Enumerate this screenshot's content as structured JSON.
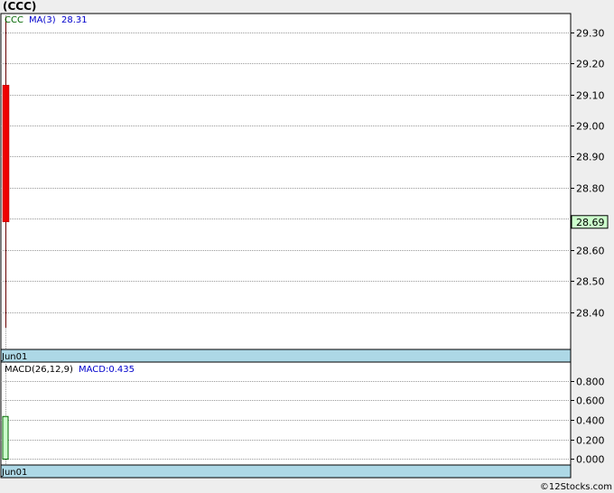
{
  "header": {
    "title": "(CCC)"
  },
  "footer": {
    "credit": "©12Stocks.com"
  },
  "chart_data": [
    {
      "type": "candlestick",
      "legend": {
        "ticker": "CCC",
        "ma_label": "MA(3)",
        "ma_value": "28.31"
      },
      "x_labels": [
        "Jun01"
      ],
      "candles": [
        {
          "date": "Jun01",
          "open": 29.13,
          "high": 29.35,
          "low": 28.35,
          "close": 28.69,
          "direction": "down"
        }
      ],
      "y_range": [
        28.28,
        29.36
      ],
      "y_ticks": [
        "29.30",
        "29.20",
        "29.10",
        "29.00",
        "28.90",
        "28.80",
        "28.70",
        "28.60",
        "28.50",
        "28.40"
      ],
      "last_price": "28.69",
      "grid": true,
      "colors": {
        "down_candle": "#ee0000",
        "wick": "#660000",
        "last_price_bg": "#ccffcc",
        "axis_band": "#add8e6",
        "ticker_text": "#006600",
        "ma_text": "#0000cc"
      }
    },
    {
      "type": "bar",
      "legend": {
        "name": "MACD(26,12,9)",
        "value_label": "MACD:0.435"
      },
      "x_labels": [
        "Jun01"
      ],
      "values": [
        0.435
      ],
      "y_range": [
        -0.06,
        0.99
      ],
      "y_ticks": [
        "0.800",
        "0.600",
        "0.400",
        "0.200",
        "0.000"
      ],
      "grid": true,
      "colors": {
        "bar_fill": "#ccffcc",
        "bar_stroke": "#006600"
      }
    }
  ]
}
